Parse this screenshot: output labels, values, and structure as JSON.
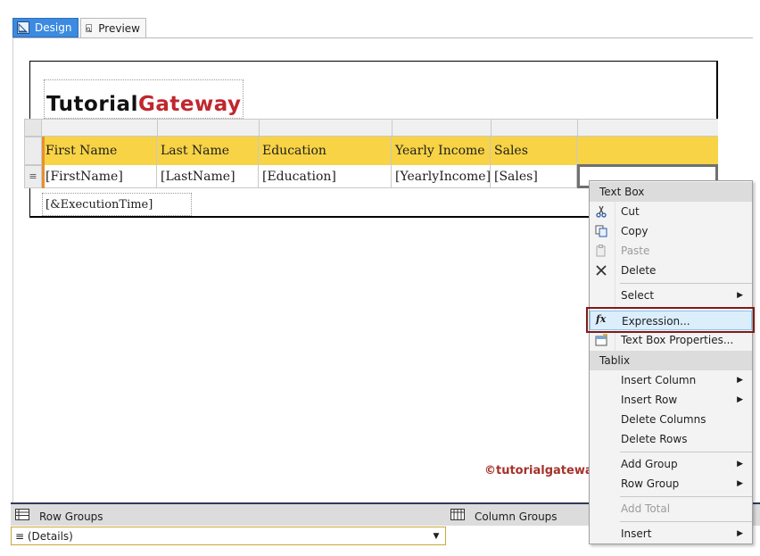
{
  "tabs": {
    "design": "Design",
    "preview": "Preview"
  },
  "logo": {
    "part1": "Tutorial",
    "part2": "Gateway"
  },
  "table": {
    "headers": [
      "First Name",
      "Last Name",
      "Education",
      "Yearly Income",
      "Sales"
    ],
    "fields": [
      "[FirstName]",
      "[LastName]",
      "[Education]",
      "[YearlyIncome]",
      "[Sales]"
    ],
    "row_handle_symbol": "≡"
  },
  "footer_expression": "[&ExecutionTime]",
  "watermark": "©tutorialgateway.org",
  "groups": {
    "row_groups": "Row Groups",
    "column_groups": "Column Groups",
    "details": "≡ (Details)"
  },
  "context_menu": {
    "section_textbox": "Text Box",
    "cut": "Cut",
    "copy": "Copy",
    "paste": "Paste",
    "delete": "Delete",
    "select": "Select",
    "expression": "Expression...",
    "textbox_properties": "Text Box Properties...",
    "section_tablix": "Tablix",
    "insert_column": "Insert Column",
    "insert_row": "Insert Row",
    "delete_columns": "Delete Columns",
    "delete_rows": "Delete Rows",
    "add_group": "Add Group",
    "row_group": "Row Group",
    "add_total": "Add Total",
    "insert": "Insert"
  }
}
